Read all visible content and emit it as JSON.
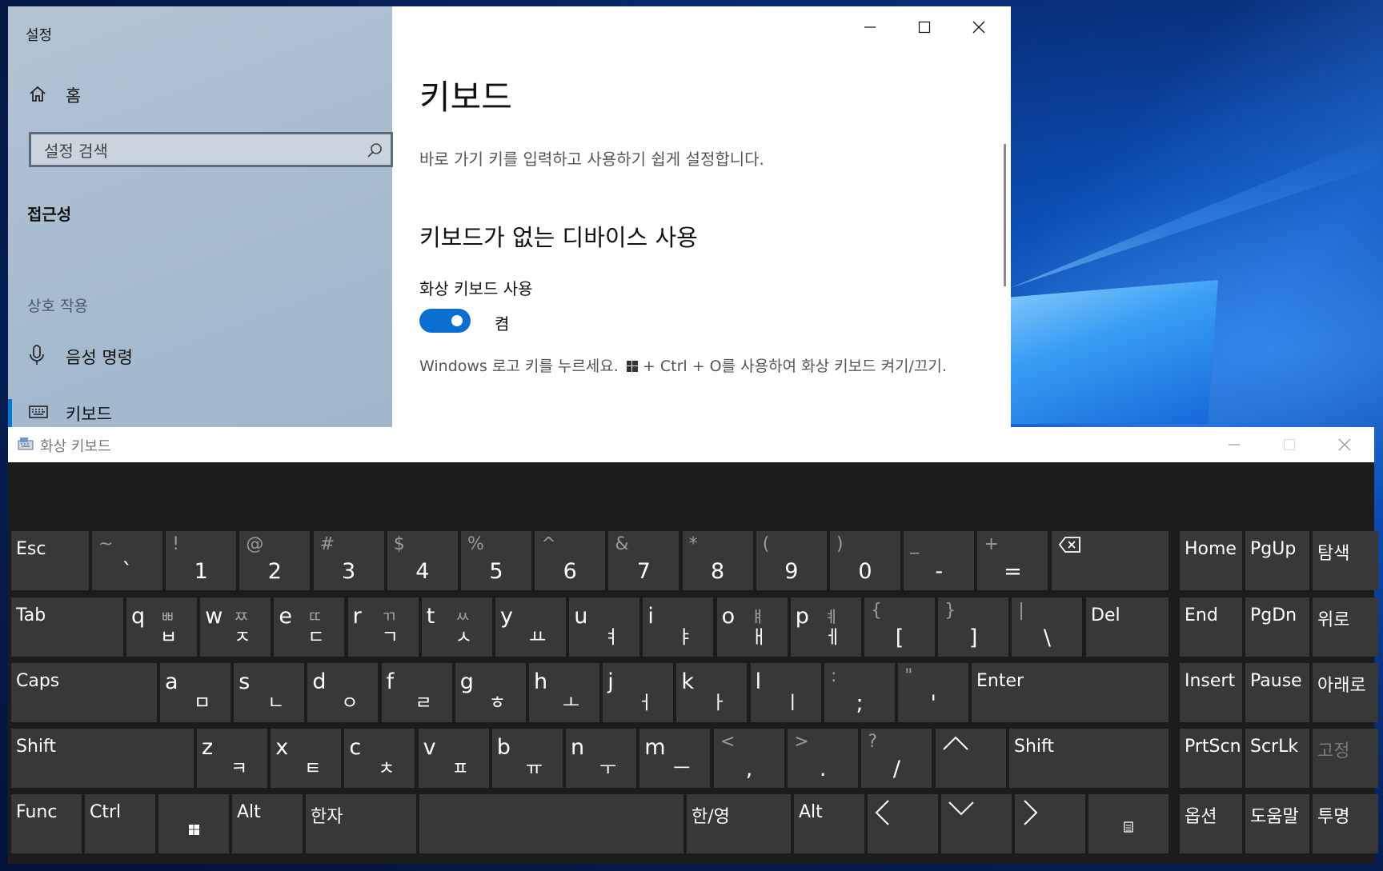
{
  "settings": {
    "app_title": "설정",
    "home_label": "홈",
    "search_placeholder": "설정 검색",
    "category": "접근성",
    "group_label": "상호 작용",
    "nav": {
      "voice": "음성 명령",
      "keyboard": "키보드"
    },
    "page_title": "키보드",
    "page_desc": "바로 가기 키를 입력하고 사용하기 쉽게 설정합니다.",
    "section_title": "키보드가 없는 디바이스 사용",
    "osk_label": "화상 키보드 사용",
    "toggle_state": "켬",
    "hint_part1": "Windows 로고 키를 누르세요.",
    "hint_part2": " + Ctrl + O를 사용하여 화상 키보드 켜기/끄기."
  },
  "osk": {
    "title": "화상 키보드",
    "colors": {
      "key_bg": "#383838",
      "board_bg": "#1c1c1c",
      "accent": "#0a6fd0"
    },
    "keys": {
      "esc": "Esc",
      "r1": [
        {
          "sec": "~",
          "pri": "`"
        },
        {
          "sec": "!",
          "pri": "1"
        },
        {
          "sec": "@",
          "pri": "2"
        },
        {
          "sec": "#",
          "pri": "3"
        },
        {
          "sec": "$",
          "pri": "4"
        },
        {
          "sec": "%",
          "pri": "5"
        },
        {
          "sec": "^",
          "pri": "6"
        },
        {
          "sec": "&",
          "pri": "7"
        },
        {
          "sec": "*",
          "pri": "8"
        },
        {
          "sec": "(",
          "pri": "9"
        },
        {
          "sec": ")",
          "pri": "0"
        },
        {
          "sec": "_",
          "pri": "-"
        },
        {
          "sec": "+",
          "pri": "="
        }
      ],
      "tab": "Tab",
      "r2": [
        {
          "lat": "q",
          "j1": "ㅃ",
          "j2": "ㅂ"
        },
        {
          "lat": "w",
          "j1": "ㅉ",
          "j2": "ㅈ"
        },
        {
          "lat": "e",
          "j1": "ㄸ",
          "j2": "ㄷ"
        },
        {
          "lat": "r",
          "j1": "ㄲ",
          "j2": "ㄱ"
        },
        {
          "lat": "t",
          "j1": "ㅆ",
          "j2": "ㅅ"
        },
        {
          "lat": "y",
          "j1": "",
          "j2": "ㅛ"
        },
        {
          "lat": "u",
          "j1": "",
          "j2": "ㅕ"
        },
        {
          "lat": "i",
          "j1": "",
          "j2": "ㅑ"
        },
        {
          "lat": "o",
          "j1": "ㅒ",
          "j2": "ㅐ"
        },
        {
          "lat": "p",
          "j1": "ㅖ",
          "j2": "ㅔ"
        }
      ],
      "r2_sym": [
        {
          "sec": "{",
          "pri": "["
        },
        {
          "sec": "}",
          "pri": "]"
        },
        {
          "sec": "|",
          "pri": "\\"
        }
      ],
      "del": "Del",
      "caps": "Caps",
      "r3": [
        {
          "lat": "a",
          "j2": "ㅁ"
        },
        {
          "lat": "s",
          "j2": "ㄴ"
        },
        {
          "lat": "d",
          "j2": "ㅇ"
        },
        {
          "lat": "f",
          "j2": "ㄹ"
        },
        {
          "lat": "g",
          "j2": "ㅎ"
        },
        {
          "lat": "h",
          "j2": "ㅗ"
        },
        {
          "lat": "j",
          "j2": "ㅓ"
        },
        {
          "lat": "k",
          "j2": "ㅏ"
        },
        {
          "lat": "l",
          "j2": "ㅣ"
        }
      ],
      "r3_sym": [
        {
          "sec": ":",
          "pri": ";"
        },
        {
          "sec": "\"",
          "pri": "'"
        }
      ],
      "enter": "Enter",
      "shift": "Shift",
      "r4": [
        {
          "lat": "z",
          "j2": "ㅋ"
        },
        {
          "lat": "x",
          "j2": "ㅌ"
        },
        {
          "lat": "c",
          "j2": "ㅊ"
        },
        {
          "lat": "v",
          "j2": "ㅍ"
        },
        {
          "lat": "b",
          "j2": "ㅠ"
        },
        {
          "lat": "n",
          "j2": "ㅜ"
        },
        {
          "lat": "m",
          "j2": "ㅡ"
        }
      ],
      "r4_sym": [
        {
          "sec": "<",
          "pri": ","
        },
        {
          "sec": ">",
          "pri": "."
        },
        {
          "sec": "?",
          "pri": "/"
        }
      ],
      "func": "Func",
      "ctrl": "Ctrl",
      "alt": "Alt",
      "hanja": "한자",
      "hanyeong": "한/영",
      "side": {
        "home": "Home",
        "pgup": "PgUp",
        "nav": "탐색",
        "end": "End",
        "pgdn": "PgDn",
        "up": "위로",
        "insert": "Insert",
        "pause": "Pause",
        "down": "아래로",
        "prtscn": "PrtScn",
        "scrlk": "ScrLk",
        "pin": "고정",
        "options": "옵션",
        "help": "도움말",
        "fade": "투명"
      }
    }
  }
}
